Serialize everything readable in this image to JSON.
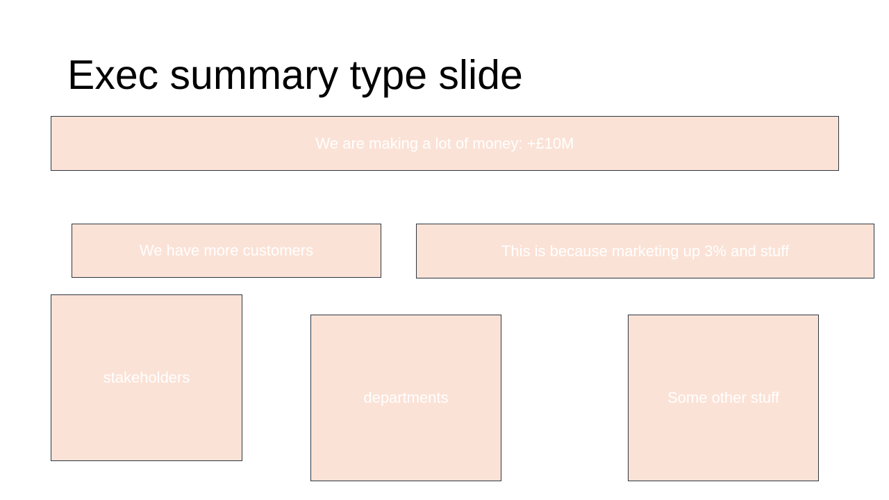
{
  "slide": {
    "title": "Exec summary type slide",
    "colors": {
      "box_fill": "#fbe2d6",
      "box_border": "#2b3540",
      "box_text": "#ffffff",
      "title_text": "#000000"
    },
    "boxes": {
      "headline": "We are making a lot of money: +£10M",
      "customers": "We have more customers",
      "marketing": "This is because marketing up 3% and stuff",
      "stakeholders": "stakeholders",
      "departments": "departments",
      "other": "Some other stuff"
    }
  }
}
